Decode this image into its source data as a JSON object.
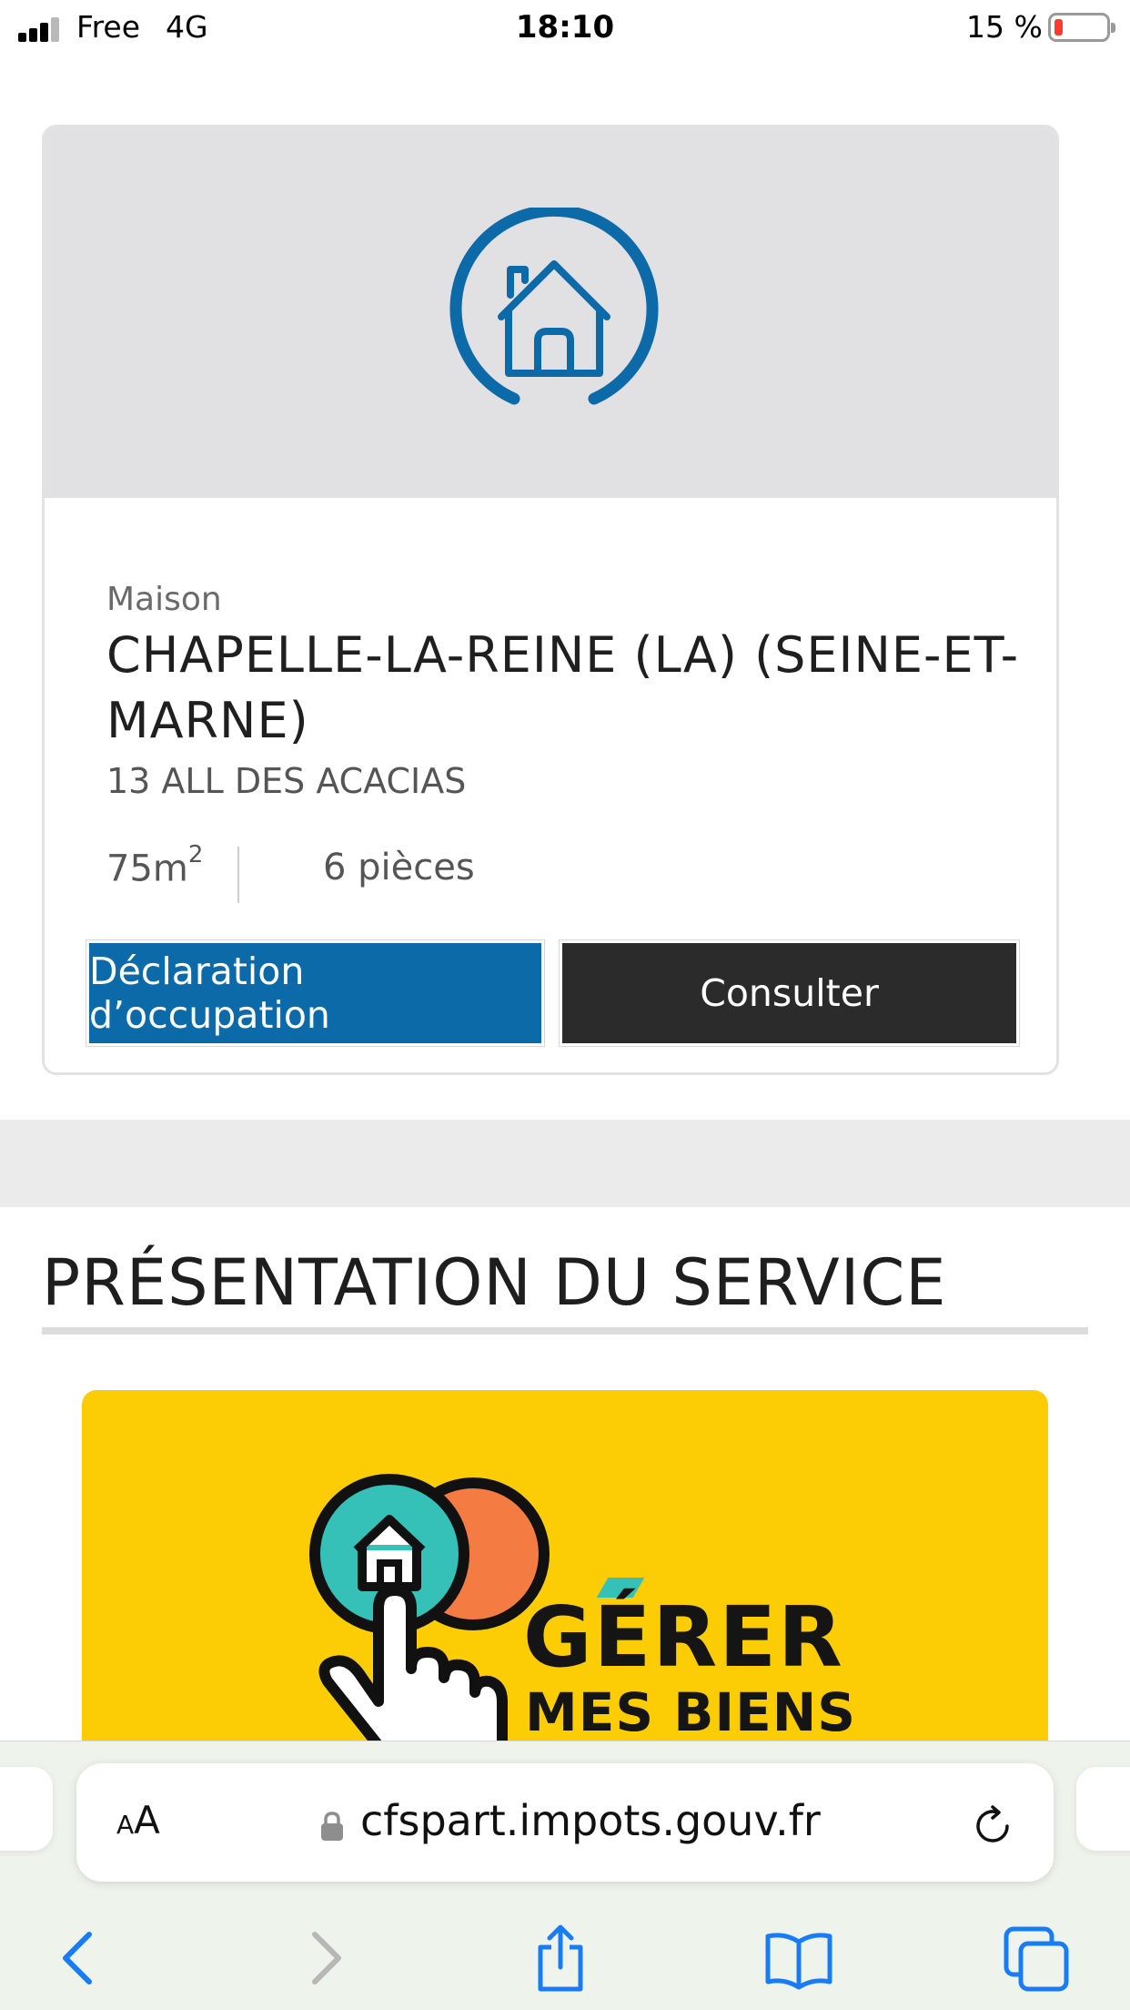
{
  "status_bar": {
    "carrier": "Free",
    "network": "4G",
    "time": "18:10",
    "battery_percent": "15 %",
    "battery_level": 0.15
  },
  "property_card": {
    "type": "Maison",
    "city": "CHAPELLE-LA-REINE (LA)   (SEINE-ET-MARNE)",
    "address": "13 ALL DES ACACIAS",
    "area_value": "75m",
    "area_exponent": "2",
    "rooms": "6 pièces",
    "buttons": {
      "declaration": "Déclaration d’occupation",
      "consult": "Consulter"
    },
    "icon": "house-in-circle-icon"
  },
  "section": {
    "title": "PRÉSENTATION DU SERVICE"
  },
  "promo_banner": {
    "line1": "GÉRER",
    "line2": "MES BIENS",
    "background": "#fccd05"
  },
  "browser": {
    "text_size_small": "A",
    "text_size_big": "A",
    "url": "cfspart.impots.gouv.fr",
    "toolbar": [
      "back-icon",
      "forward-icon",
      "share-icon",
      "bookmarks-icon",
      "tabs-icon"
    ]
  },
  "colors": {
    "primary_blue": "#0d6aa8",
    "dark_button": "#2b2b2b",
    "safari_blue": "#1a7cf5"
  }
}
